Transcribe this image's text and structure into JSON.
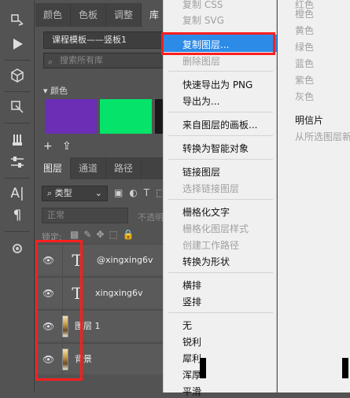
{
  "toolbar": {
    "tools": [
      "history-brush-icon",
      "play-action-icon",
      "3d-cube-icon",
      "crop-frame-icon",
      "puppet-warp-icon",
      "adjust-sliders-icon",
      "text-paragraph-icon",
      "paragraph-icon",
      "settings-gear-icon"
    ],
    "text_tool_label": "A|",
    "paragraph_label": "¶"
  },
  "library": {
    "tabs": [
      "颜色",
      "色板",
      "调整",
      "库"
    ],
    "active_tab": "库",
    "current_library": "课程模板——竖板1",
    "search_placeholder": "搜索所有库",
    "colors_section": "颜色",
    "swatches": [
      "#6b2eb4",
      "#05e36a",
      "#1a1a1a"
    ],
    "footer_plus": "+",
    "footer_upload": "⇪"
  },
  "layers": {
    "tabs": [
      "图层",
      "通道",
      "路径"
    ],
    "active_tab": "图层",
    "kind_filter": "类型",
    "filter_icons": "▣◐T⬚",
    "blend_mode": "正常",
    "opacity_label": "不透明",
    "lock_label": "锁定:",
    "lock_icons": "▩✎✥⬚🔒",
    "rows": [
      {
        "type": "text",
        "name": "@xingxing6v",
        "thumb": "T"
      },
      {
        "type": "text",
        "name": "xingxing6v",
        "thumb": "T"
      },
      {
        "type": "image",
        "name": "图层 1"
      },
      {
        "type": "image",
        "name": "背景"
      }
    ]
  },
  "menu": {
    "items": [
      {
        "label": "复制 CSS",
        "enabled": false
      },
      {
        "label": "复制 SVG",
        "enabled": false
      },
      {
        "label": "复制图层...",
        "enabled": true,
        "highlighted": true
      },
      {
        "label": "删除图层",
        "enabled": false
      },
      {
        "label": "快速导出为 PNG",
        "enabled": true
      },
      {
        "label": "导出为...",
        "enabled": true
      },
      {
        "label": "来自图层的画板...",
        "enabled": true
      },
      {
        "label": "转换为智能对象",
        "enabled": true
      },
      {
        "label": "链接图层",
        "enabled": true
      },
      {
        "label": "选择链接图层",
        "enabled": false
      },
      {
        "label": "栅格化文字",
        "enabled": true
      },
      {
        "label": "栅格化图层样式",
        "enabled": false
      },
      {
        "label": "创建工作路径",
        "enabled": false
      },
      {
        "label": "转换为形状",
        "enabled": true
      },
      {
        "label": "横排",
        "enabled": true
      },
      {
        "label": "竖排",
        "enabled": true
      },
      {
        "label": "无",
        "enabled": true
      },
      {
        "label": "锐利",
        "enabled": true
      },
      {
        "label": "犀利",
        "enabled": true
      },
      {
        "label": "浑厚",
        "enabled": true
      },
      {
        "label": "平滑",
        "enabled": true
      }
    ]
  },
  "submenu": {
    "items": [
      {
        "label": "红色",
        "enabled": false
      },
      {
        "label": "橙色",
        "enabled": false
      },
      {
        "label": "黄色",
        "enabled": false
      },
      {
        "label": "绿色",
        "enabled": false
      },
      {
        "label": "蓝色",
        "enabled": false
      },
      {
        "label": "紫色",
        "enabled": false
      },
      {
        "label": "灰色",
        "enabled": false
      },
      {
        "label": "明信片",
        "enabled": true
      },
      {
        "label": "从所选图层新",
        "enabled": false
      }
    ]
  },
  "colors": {
    "highlight": "#2d8be8",
    "annotation_red": "#ff1e1e"
  }
}
